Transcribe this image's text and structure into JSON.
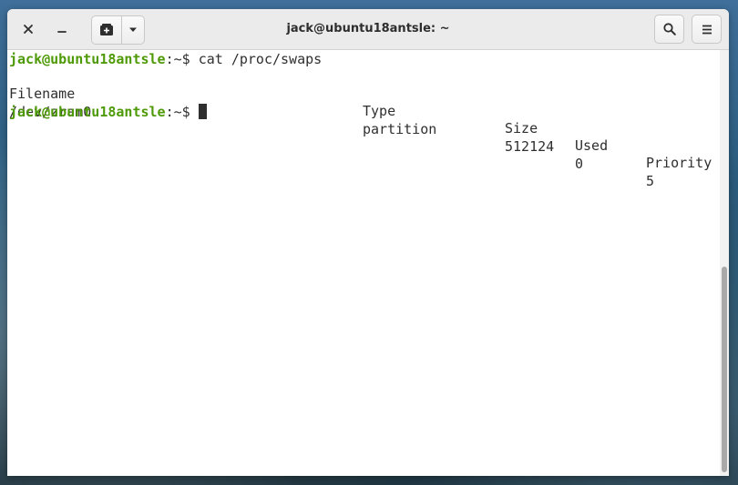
{
  "window": {
    "title": "jack@ubuntu18antsle: ~",
    "icons": {
      "close": "close-icon",
      "minimize": "minimize-icon",
      "new_tab": "new-tab-icon",
      "tab_menu": "chevron-down-icon",
      "search": "search-icon",
      "menu": "hamburger-icon"
    }
  },
  "terminal": {
    "prompt": "jack@ubuntu18antsle",
    "prompt_suffix": ":~$ ",
    "command": "cat /proc/swaps",
    "headers": [
      "Filename",
      "Type",
      "Size",
      "Used",
      "Priority"
    ],
    "rows": [
      [
        "/dev/zram0",
        "partition",
        "512124",
        "0",
        "5"
      ]
    ],
    "prompt_color": "#4e9a06"
  }
}
